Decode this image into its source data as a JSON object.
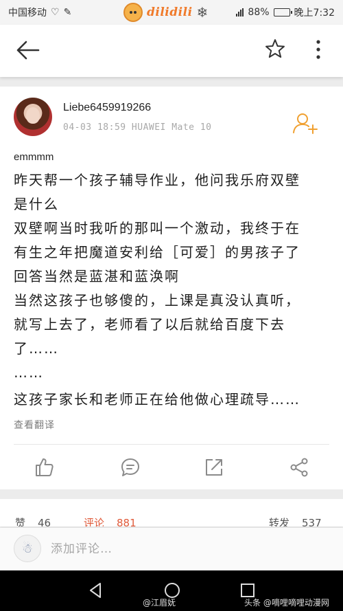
{
  "status_bar": {
    "carrier": "中国移动",
    "brand_text": "dilidili",
    "battery": "88%",
    "time": "晚上7:32",
    "battery_level": 0.88
  },
  "post": {
    "username": "Liebe6459919266",
    "meta": "04-03 18:59 HUAWEI Mate 10",
    "preface": "emmmm",
    "lines": [
      "昨天帮一个孩子辅导作业，他问我乐府双壁",
      "是什么",
      "双壁啊当时我听的那叫一个激动，我终于在",
      "有生之年把魔道安利给［可爱］的男孩子了",
      "回答当然是蓝湛和蓝涣啊",
      "当然这孩子也够傻的，上课是真没认真听，",
      "就写上去了，老师看了以后就给百度下去",
      "了……",
      "……",
      "这孩子家长和老师正在给他做心理疏导……"
    ],
    "translate": "查看翻译"
  },
  "stats": {
    "likes_label": "赞",
    "likes": "46",
    "comments_label": "评论",
    "comments": "881",
    "reposts_label": "转发",
    "reposts": "537"
  },
  "comment": {
    "placeholder": "添加评论…"
  },
  "watermark": {
    "left": "@江眉妩",
    "right": "头条 @嘀哩嘀哩动漫网"
  },
  "colors": {
    "accent": "#e05a3a",
    "follow": "#f0a030",
    "icon": "#8a8a8a"
  }
}
